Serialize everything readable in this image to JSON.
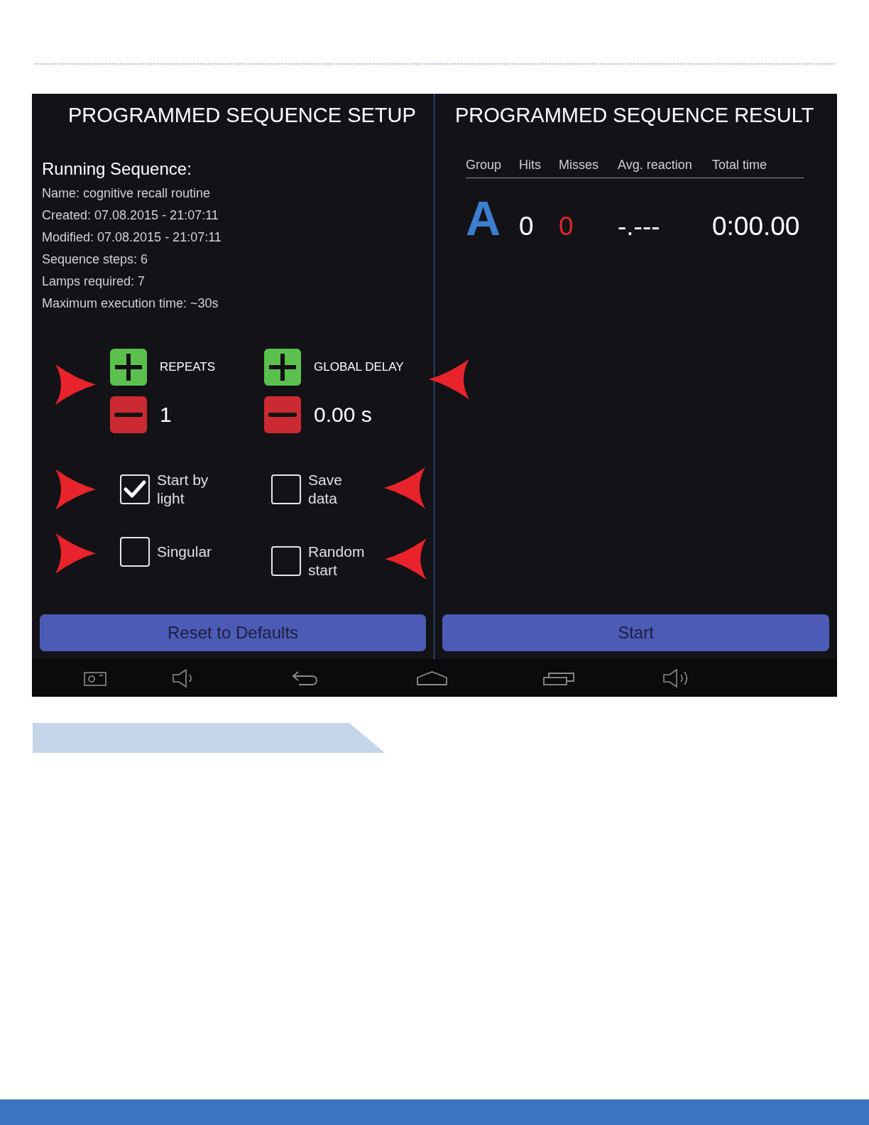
{
  "setup": {
    "title": "PROGRAMMED SEQUENCE SETUP",
    "heading": "Running Sequence:",
    "details": [
      "Name: cognitive recall routine",
      "Created: 07.08.2015 - 21:07:11",
      "Modified: 07.08.2015 - 21:07:11",
      "Sequence steps: 6",
      "Lamps required: 7",
      "Maximum execution time: ~30s"
    ],
    "steppers": [
      {
        "label": "REPEATS",
        "value": "1"
      },
      {
        "label": "GLOBAL DELAY",
        "value": "0.00 s"
      }
    ],
    "options": [
      {
        "label": "Start by light",
        "checked": true
      },
      {
        "label": "Save data",
        "checked": false
      },
      {
        "label": "Singular",
        "checked": false
      },
      {
        "label": "Random start",
        "checked": false
      }
    ],
    "button": "Reset to Defaults"
  },
  "result": {
    "title": "PROGRAMMED SEQUENCE RESULT",
    "columns": [
      "Group",
      "Hits",
      "Misses",
      "Avg. reaction",
      "Total time"
    ],
    "rows": [
      [
        "A",
        "0",
        "0",
        "-.---",
        "0:00.00"
      ]
    ],
    "button": "Start"
  }
}
